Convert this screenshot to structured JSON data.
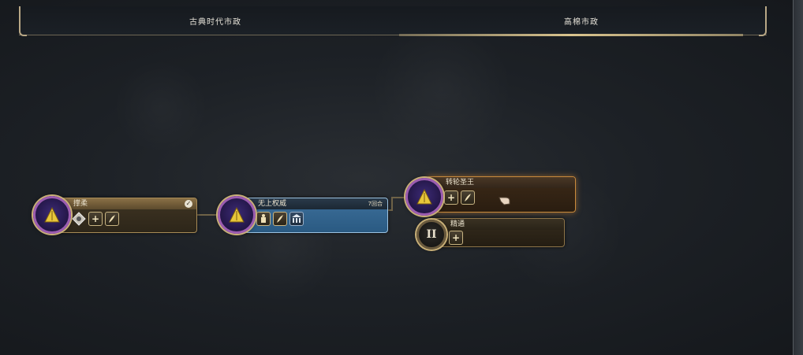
{
  "tabs": [
    {
      "label": "古典时代市政",
      "active": false
    },
    {
      "label": "高棉市政",
      "active": true
    }
  ],
  "nodes": {
    "n1": {
      "name": "撑柔",
      "icon": "govt-pyramid-icon",
      "completed": true,
      "unlocks": [
        "diamond-unit-icon",
        "plus-icon",
        "quill-icon"
      ]
    },
    "n2": {
      "name": "无上权威",
      "turns": "7回合",
      "icon": "govt-pyramid-icon",
      "unlocks": [
        "statue-icon",
        "quill-icon",
        "government-building-icon"
      ]
    },
    "n3": {
      "name": "转轮圣王",
      "icon": "govt-pyramid-icon",
      "unlocks": [
        "plus-icon",
        "quill-icon"
      ]
    },
    "n4": {
      "name": "精通",
      "icon": "roman-numeral-two-icon",
      "medal_text": "II",
      "unlocks": [
        "plus-icon"
      ]
    }
  },
  "colors": {
    "accent_gold": "#c8b482",
    "in_progress_blue": "#3d6f9a",
    "selected_orange": "#c98a3c",
    "medal_purple": "#9b5cb0"
  }
}
